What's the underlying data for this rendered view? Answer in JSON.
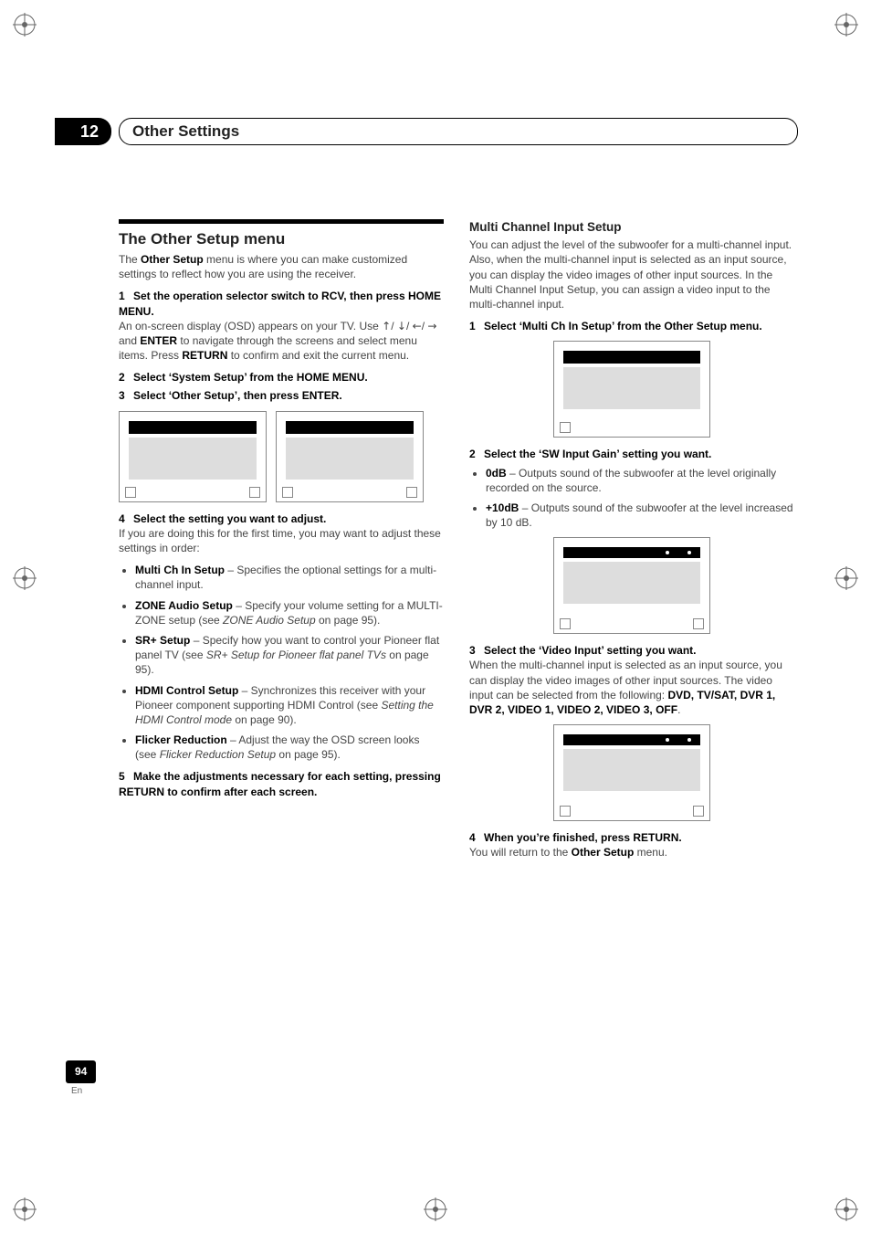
{
  "header": {
    "chapter_number": "12",
    "chapter_title": "Other Settings"
  },
  "left": {
    "section_title": "The Other Setup menu",
    "intro_a": "The ",
    "intro_b": "Other Setup",
    "intro_c": " menu is where you can make customized settings to reflect how you are using the receiver.",
    "step1": "Set the operation selector switch to RCV, then press HOME MENU.",
    "step1_body_a": "An on-screen display (OSD) appears on your TV. Use ",
    "step1_body_b": " and ",
    "step1_body_c": "ENTER",
    "step1_body_d": " to navigate through the screens and select menu items. Press ",
    "step1_body_e": "RETURN",
    "step1_body_f": " to confirm and exit the current menu.",
    "step2": "Select ‘System Setup’ from the HOME MENU.",
    "step3": "Select ‘Other Setup’, then press ENTER.",
    "step4": "Select the setting you want to adjust.",
    "step4_body": "If you are doing this for the first time, you may want to adjust these settings in order:",
    "bullets": [
      {
        "lead": "Multi Ch In Setup",
        "rest": " – Specifies the optional settings for a multi-channel input."
      },
      {
        "lead": "ZONE Audio Setup",
        "rest": " – Specify your volume setting for a MULTI-ZONE setup (see ",
        "ital": "ZONE Audio Setup",
        "tail": " on page 95)."
      },
      {
        "lead": "SR+ Setup",
        "rest": " – Specify how you want to control your Pioneer flat panel TV (see ",
        "ital": "SR+ Setup for Pioneer flat panel TVs",
        "tail": " on page 95)."
      },
      {
        "lead": "HDMI Control Setup",
        "rest": " – Synchronizes this receiver with your Pioneer component supporting HDMI Control (see ",
        "ital": "Setting the HDMI Control mode",
        "tail": " on page 90)."
      },
      {
        "lead": "Flicker Reduction",
        "rest": " – Adjust the way the OSD screen looks (see ",
        "ital": "Flicker Reduction Setup",
        "tail": " on page 95)."
      }
    ],
    "step5": "Make the adjustments necessary for each setting, pressing RETURN to confirm after each screen."
  },
  "right": {
    "sub_title": "Multi Channel Input Setup",
    "intro": "You can adjust the level of the subwoofer for a multi-channel input. Also, when the multi-channel input is selected as an input source, you can display the video images of other input sources. In the Multi Channel Input Setup, you can assign a video input to the multi-channel input.",
    "step1": "Select ‘Multi Ch In Setup’ from the Other Setup menu.",
    "step2": "Select the ‘SW Input Gain’ setting you want.",
    "sw_bullets": [
      {
        "lead": "0dB",
        "rest": " – Outputs sound of the subwoofer at the level originally recorded on the source."
      },
      {
        "lead": "+10dB",
        "rest": " – Outputs sound of the subwoofer at the level increased by 10 dB."
      }
    ],
    "step3": "Select the ‘Video Input’ setting you want.",
    "video_body_a": "When the multi-channel input is selected as an input source, you can display the video images of other input sources. The video input can be selected from the following: ",
    "video_opts": "DVD, TV/SAT, DVR 1, DVR 2, VIDEO 1, VIDEO 2, VIDEO 3, OFF",
    "video_body_b": ".",
    "step4": "When you’re finished, press RETURN.",
    "step4_body": "You will return to the ",
    "step4_bold": "Other Setup",
    "step4_tail": " menu."
  },
  "footer": {
    "page": "94",
    "lang": "En"
  },
  "glyphs": {
    "up": "↑",
    "down": "↓",
    "left": "←",
    "right": "→",
    "sep": "/"
  }
}
